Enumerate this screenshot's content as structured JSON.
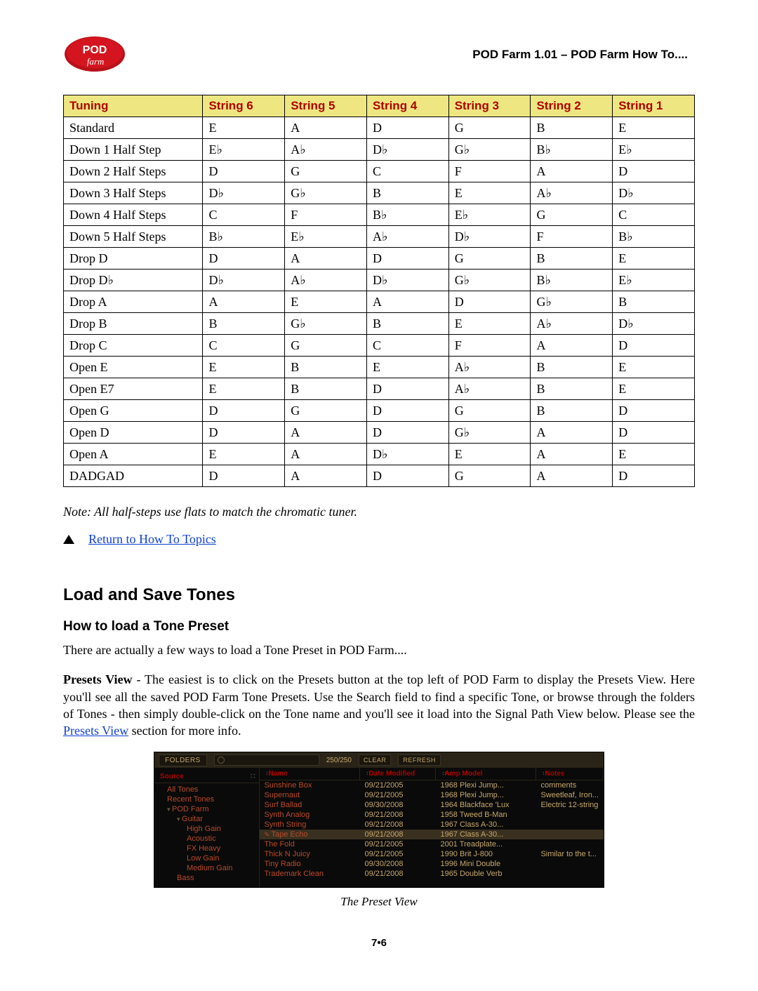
{
  "header": {
    "title": "POD Farm 1.01 – POD Farm How To...."
  },
  "table": {
    "headers": [
      "Tuning",
      "String 6",
      "String 5",
      "String 4",
      "String 3",
      "String 2",
      "String 1"
    ],
    "rows": [
      [
        "Standard",
        "E",
        "A",
        "D",
        "G",
        "B",
        "E"
      ],
      [
        "Down 1 Half Step",
        "E♭",
        "A♭",
        "D♭",
        "G♭",
        "B♭",
        "E♭"
      ],
      [
        "Down 2 Half Steps",
        "D",
        "G",
        "C",
        "F",
        "A",
        "D"
      ],
      [
        "Down 3 Half Steps",
        "D♭",
        "G♭",
        "B",
        "E",
        "A♭",
        "D♭"
      ],
      [
        "Down 4 Half Steps",
        "C",
        "F",
        "B♭",
        "E♭",
        "G",
        "C"
      ],
      [
        "Down 5 Half Steps",
        "B♭",
        "E♭",
        "A♭",
        "D♭",
        "F",
        "B♭"
      ],
      [
        "Drop D",
        "D",
        "A",
        "D",
        "G",
        "B",
        "E"
      ],
      [
        "Drop D♭",
        "D♭",
        "A♭",
        "D♭",
        "G♭",
        "B♭",
        "E♭"
      ],
      [
        "Drop A",
        "A",
        "E",
        "A",
        "D",
        "G♭",
        "B"
      ],
      [
        "Drop B",
        "B",
        "G♭",
        "B",
        "E",
        "A♭",
        "D♭"
      ],
      [
        "Drop C",
        "C",
        "G",
        "C",
        "F",
        "A",
        "D"
      ],
      [
        "Open E",
        "E",
        "B",
        "E",
        "A♭",
        "B",
        "E"
      ],
      [
        "Open E7",
        "E",
        "B",
        "D",
        "A♭",
        "B",
        "E"
      ],
      [
        "Open G",
        "D",
        "G",
        "D",
        "G",
        "B",
        "D"
      ],
      [
        "Open D",
        "D",
        "A",
        "D",
        "G♭",
        "A",
        "D"
      ],
      [
        "Open A",
        "E",
        "A",
        "D♭",
        "E",
        "A",
        "E"
      ],
      [
        "DADGAD",
        "D",
        "A",
        "D",
        "G",
        "A",
        "D"
      ]
    ]
  },
  "note": "Note: All half-steps use flats to match the chromatic tuner.",
  "return_link": "Return to How To Topics",
  "section_title": "Load and Save Tones",
  "subsection_title": "How to load a Tone Preset",
  "para1": "There are actually a few ways to load a Tone Preset in POD Farm....",
  "para2_pre": "Presets View",
  "para2_body": " - The easiest is to click on the Presets button at the top left of POD Farm to display the Presets View. Here you'll see all the saved POD Farm Tone Presets. Use the Search field to find a specific Tone, or browse through the folders of Tones - then simply double-click on the Tone name and you'll see it load into the Signal Path View below.  Please see the ",
  "para2_link": "Presets View",
  "para2_tail": " section for more info.",
  "preset_view": {
    "folders_label": "FOLDERS",
    "count": "250/250",
    "clear": "CLEAR",
    "refresh": "REFRESH",
    "left_header": "Source",
    "tree": [
      {
        "label": "All Tones",
        "lvl": 1
      },
      {
        "label": "Recent Tones",
        "lvl": 1
      },
      {
        "label": "POD Farm",
        "lvl": 1,
        "expd": true
      },
      {
        "label": "Guitar",
        "lvl": 2,
        "expd": true
      },
      {
        "label": "High Gain",
        "lvl": 3
      },
      {
        "label": "Acoustic",
        "lvl": 3
      },
      {
        "label": "FX Heavy",
        "lvl": 3
      },
      {
        "label": "Low Gain",
        "lvl": 3
      },
      {
        "label": "Medium Gain",
        "lvl": 3
      },
      {
        "label": "Bass",
        "lvl": 2
      }
    ],
    "columns": [
      "Name",
      "Date Modified",
      "Amp Model",
      "Notes"
    ],
    "rows": [
      {
        "name": "Sunshine Box",
        "date": "09/21/2005",
        "amp": "1968 Plexi Jump...",
        "notes": "comments"
      },
      {
        "name": "Supernaut",
        "date": "09/21/2005",
        "amp": "1968 Plexi Jump...",
        "notes": "Sweetleaf, Iron..."
      },
      {
        "name": "Surf Ballad",
        "date": "09/30/2008",
        "amp": "1964 Blackface 'Lux",
        "notes": "Electric 12-string"
      },
      {
        "name": "Synth Analog",
        "date": "09/21/2008",
        "amp": "1958 Tweed B-Man",
        "notes": ""
      },
      {
        "name": "Synth String",
        "date": "09/21/2008",
        "amp": "1967 Class A-30...",
        "notes": ""
      },
      {
        "name": "Tape Echo",
        "date": "09/21/2008",
        "amp": "1967 Class A-30...",
        "notes": "",
        "sel": true
      },
      {
        "name": "The Fold",
        "date": "09/21/2005",
        "amp": "2001 Treadplate...",
        "notes": ""
      },
      {
        "name": "Thick N Juicy",
        "date": "09/21/2005",
        "amp": "1990 Brit J-800",
        "notes": "Similar to the t..."
      },
      {
        "name": "Tiny Radio",
        "date": "09/30/2008",
        "amp": "1996 Mini Double",
        "notes": ""
      },
      {
        "name": "Trademark Clean",
        "date": "09/21/2008",
        "amp": "1965 Double Verb",
        "notes": ""
      }
    ]
  },
  "caption": "The Preset View",
  "pagenum": "7•6"
}
